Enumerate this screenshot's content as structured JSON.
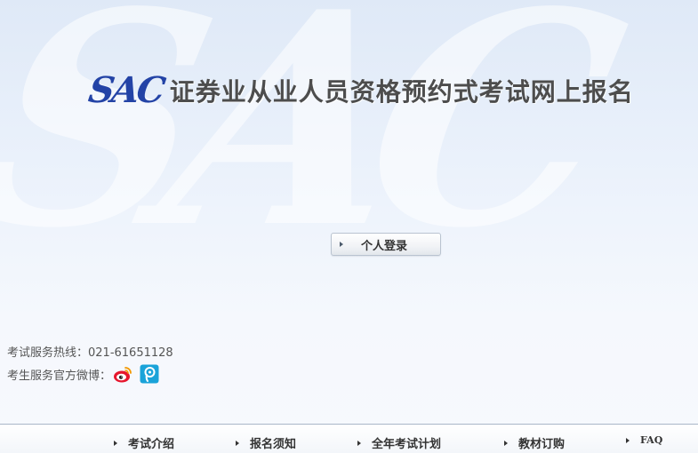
{
  "header": {
    "logo_text": "SAC",
    "title": "证券业从业人员资格预约式考试网上报名"
  },
  "watermark": "SAC",
  "login": {
    "label": "个人登录"
  },
  "contact": {
    "hotline": "考试服务热线：021-61651128",
    "weibo_label": "考生服务官方微博："
  },
  "footer_nav": [
    {
      "label": "考试介绍"
    },
    {
      "label": "报名须知"
    },
    {
      "label": "全年考试计划"
    },
    {
      "label": "教材订购"
    },
    {
      "label": "FAQ"
    }
  ],
  "colors": {
    "brand_blue": "#2343a6",
    "title_gray": "#4d4d4d",
    "weibo_red": "#e6162d",
    "tweibo_cyan": "#1aa3d9"
  },
  "icons": [
    "sina-weibo-icon",
    "tencent-weibo-icon",
    "arrow-right-icon"
  ]
}
